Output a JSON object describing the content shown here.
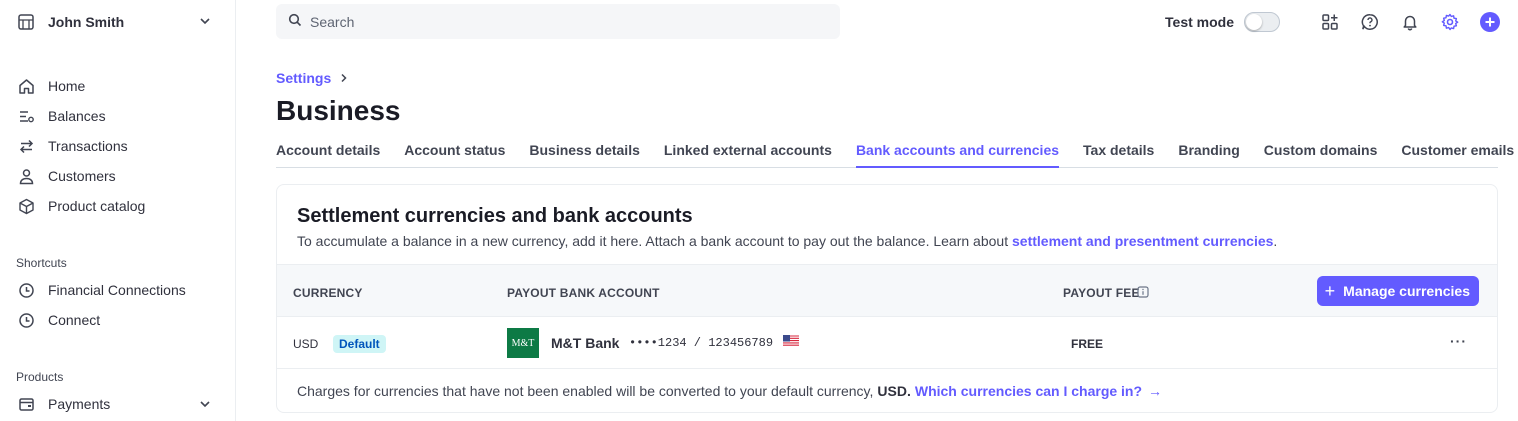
{
  "account": {
    "name": "John Smith"
  },
  "nav": {
    "main": [
      {
        "label": "Home",
        "icon": "home-icon"
      },
      {
        "label": "Balances",
        "icon": "balances-icon"
      },
      {
        "label": "Transactions",
        "icon": "transactions-icon"
      },
      {
        "label": "Customers",
        "icon": "customers-icon"
      },
      {
        "label": "Product catalog",
        "icon": "product-catalog-icon"
      }
    ],
    "shortcuts_title": "Shortcuts",
    "shortcuts": [
      {
        "label": "Financial Connections",
        "icon": "clock-icon"
      },
      {
        "label": "Connect",
        "icon": "clock-icon"
      }
    ],
    "products_title": "Products",
    "products": [
      {
        "label": "Payments",
        "icon": "payments-icon"
      }
    ]
  },
  "search": {
    "placeholder": "Search"
  },
  "topbar": {
    "test_mode_label": "Test mode",
    "test_mode_on": false
  },
  "breadcrumb": {
    "parent": "Settings"
  },
  "page": {
    "title": "Business"
  },
  "tabs": [
    {
      "label": "Account details",
      "active": false
    },
    {
      "label": "Account status",
      "active": false
    },
    {
      "label": "Business details",
      "active": false
    },
    {
      "label": "Linked external accounts",
      "active": false
    },
    {
      "label": "Bank accounts and currencies",
      "active": true
    },
    {
      "label": "Tax details",
      "active": false
    },
    {
      "label": "Branding",
      "active": false
    },
    {
      "label": "Custom domains",
      "active": false
    },
    {
      "label": "Customer emails",
      "active": false
    }
  ],
  "card": {
    "title": "Settlement currencies and bank accounts",
    "description": "To accumulate a balance in a new currency, add it here. Attach a bank account to pay out the balance. Learn about",
    "description_link": "settlement and presentment currencies",
    "description_end": ".",
    "columns": {
      "currency": "CURRENCY",
      "payout_account": "PAYOUT BANK ACCOUNT",
      "payout_fee": "PAYOUT FEE"
    },
    "manage_button": "Manage currencies",
    "row": {
      "currency": "USD",
      "badge": "Default",
      "bank_logo_text": "M&T",
      "bank_name": "M&T Bank",
      "account_number": "••••1234 / 123456789",
      "fee": "FREE",
      "more": "···"
    },
    "footer": {
      "text": "Charges for currencies that have not been enabled will be converted to your default currency,",
      "currency": "USD.",
      "link": "Which currencies can I charge in?",
      "link_arrow": "→"
    }
  },
  "colors": {
    "accent": "#635bff",
    "bank_green": "#0d7a45",
    "badge_bg": "#cff5f6"
  }
}
